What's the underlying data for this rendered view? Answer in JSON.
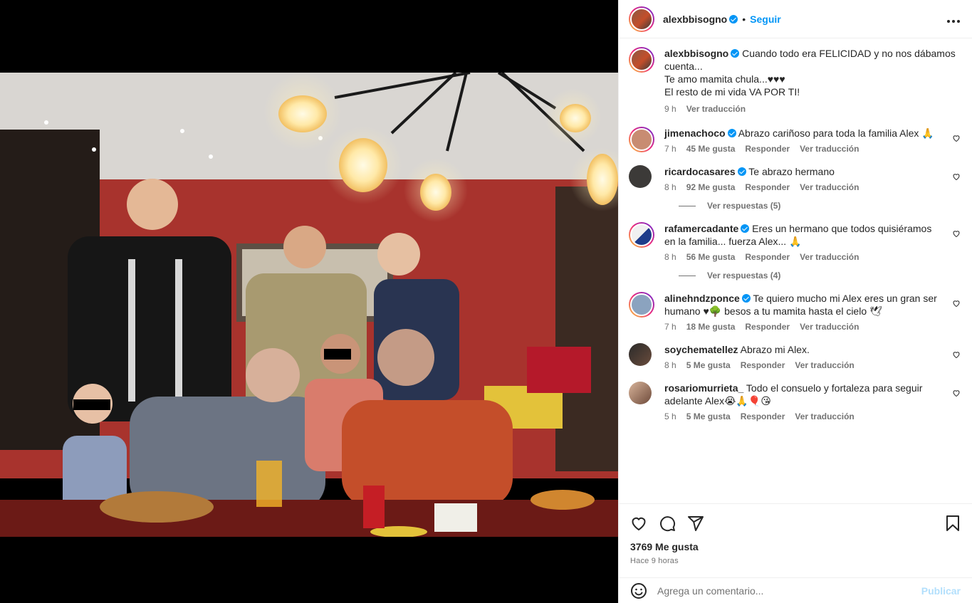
{
  "post": {
    "author": "alexbbisogno",
    "follow_label": "Seguir",
    "dot": "•",
    "more_icon": "more-horizontal-icon",
    "caption_lines": [
      "Cuando todo era FELICIDAD y no nos dábamos cuenta...",
      "Te amo mamita chula...♥♥♥",
      "El resto de mi vida VA POR TI!"
    ],
    "caption_time": "9 h",
    "caption_translate": "Ver traducción"
  },
  "comments": [
    {
      "user": "jimenachoco",
      "verified": true,
      "text": "Abrazo cariñoso para toda la familia Alex 🙏",
      "time": "7 h",
      "likes": "45 Me gusta",
      "reply": "Responder",
      "translate": "Ver traducción",
      "replies": ""
    },
    {
      "user": "ricardocasares",
      "verified": true,
      "text": "Te abrazo hermano",
      "time": "8 h",
      "likes": "92 Me gusta",
      "reply": "Responder",
      "translate": "Ver traducción",
      "replies": "Ver respuestas (5)"
    },
    {
      "user": "rafamercadante",
      "verified": true,
      "text": "Eres un hermano que todos quisiéramos en la familia... fuerza Alex... 🙏",
      "time": "8 h",
      "likes": "56 Me gusta",
      "reply": "Responder",
      "translate": "Ver traducción",
      "replies": "Ver respuestas (4)"
    },
    {
      "user": "alinehndzponce",
      "verified": true,
      "text": "Te quiero mucho mi Alex eres un gran ser humano ♥🌳 besos a tu mamita hasta el cielo 🕊",
      "time": "7 h",
      "likes": "18 Me gusta",
      "reply": "Responder",
      "translate": "Ver traducción",
      "replies": ""
    },
    {
      "user": "soychematellez",
      "verified": false,
      "text": "Abrazo mi Alex.",
      "time": "8 h",
      "likes": "5 Me gusta",
      "reply": "Responder",
      "translate": "Ver traducción",
      "replies": ""
    },
    {
      "user": "rosariomurrieta_",
      "verified": false,
      "text": "Todo el consuelo y fortaleza para seguir adelante Alex😭🙏🎈😘",
      "time": "5 h",
      "likes": "5 Me gusta",
      "reply": "Responder",
      "translate": "Ver traducción",
      "replies": ""
    }
  ],
  "actions": {
    "like_icon": "heart-icon",
    "comment_icon": "comment-icon",
    "share_icon": "send-icon",
    "save_icon": "bookmark-icon",
    "likes_count": "3769 Me gusta",
    "posted_ago": "Hace 9 horas"
  },
  "composer": {
    "emoji_icon": "emoji-icon",
    "placeholder": "Agrega un comentario...",
    "publish_label": "Publicar"
  },
  "colors": {
    "accent": "#0095f6",
    "publish_disabled": "#b2dffc",
    "wall_red": "#a8332d"
  }
}
